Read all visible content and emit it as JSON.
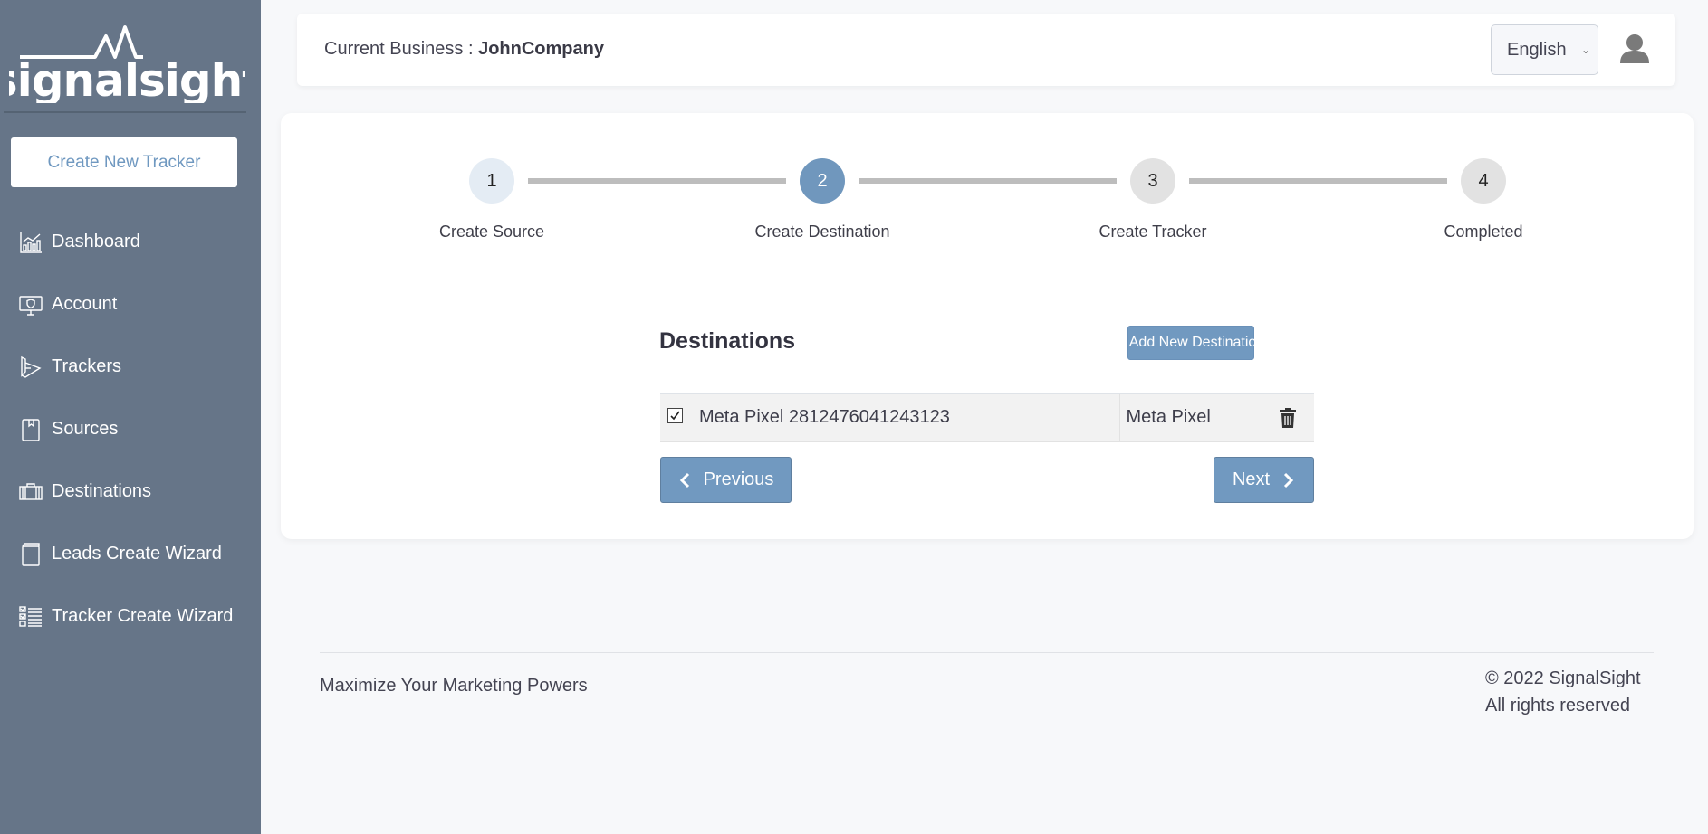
{
  "sidebar": {
    "logo_text": "signalsight",
    "create_button": "Create New Tracker",
    "items": [
      {
        "label": "Dashboard",
        "icon": "chart-bar-icon"
      },
      {
        "label": "Account",
        "icon": "monitor-shield-icon"
      },
      {
        "label": "Trackers",
        "icon": "play-arrow-icon"
      },
      {
        "label": "Sources",
        "icon": "bookmark-book-icon"
      },
      {
        "label": "Destinations",
        "icon": "suitcase-icon"
      },
      {
        "label": "Leads Create Wizard",
        "icon": "book-icon"
      },
      {
        "label": "Tracker Create Wizard",
        "icon": "checklist-icon"
      }
    ]
  },
  "header": {
    "business_label": "Current Business : ",
    "business_name": "JohnCompany",
    "language": "English"
  },
  "stepper": {
    "current_step": 2,
    "steps": [
      {
        "number": "1",
        "label": "Create Source",
        "state": "done"
      },
      {
        "number": "2",
        "label": "Create Destination",
        "state": "active"
      },
      {
        "number": "3",
        "label": "Create Tracker",
        "state": "todo"
      },
      {
        "number": "4",
        "label": "Completed",
        "state": "todo"
      }
    ]
  },
  "destinations": {
    "title": "Destinations",
    "add_button": "+ Add New Destination",
    "rows": [
      {
        "checked": true,
        "name": "Meta Pixel 2812476041243123",
        "type": "Meta Pixel"
      }
    ],
    "previous_button": "Previous",
    "next_button": "Next"
  },
  "footer": {
    "tagline": "Maximize Your Marketing Powers",
    "copyright": "© 2022 SignalSight",
    "rights": "All rights reserved"
  },
  "colors": {
    "sidebar_bg": "#667588",
    "accent": "#7199c0",
    "step_done": "#e4ecf4",
    "step_todo": "#e2e2e2"
  }
}
